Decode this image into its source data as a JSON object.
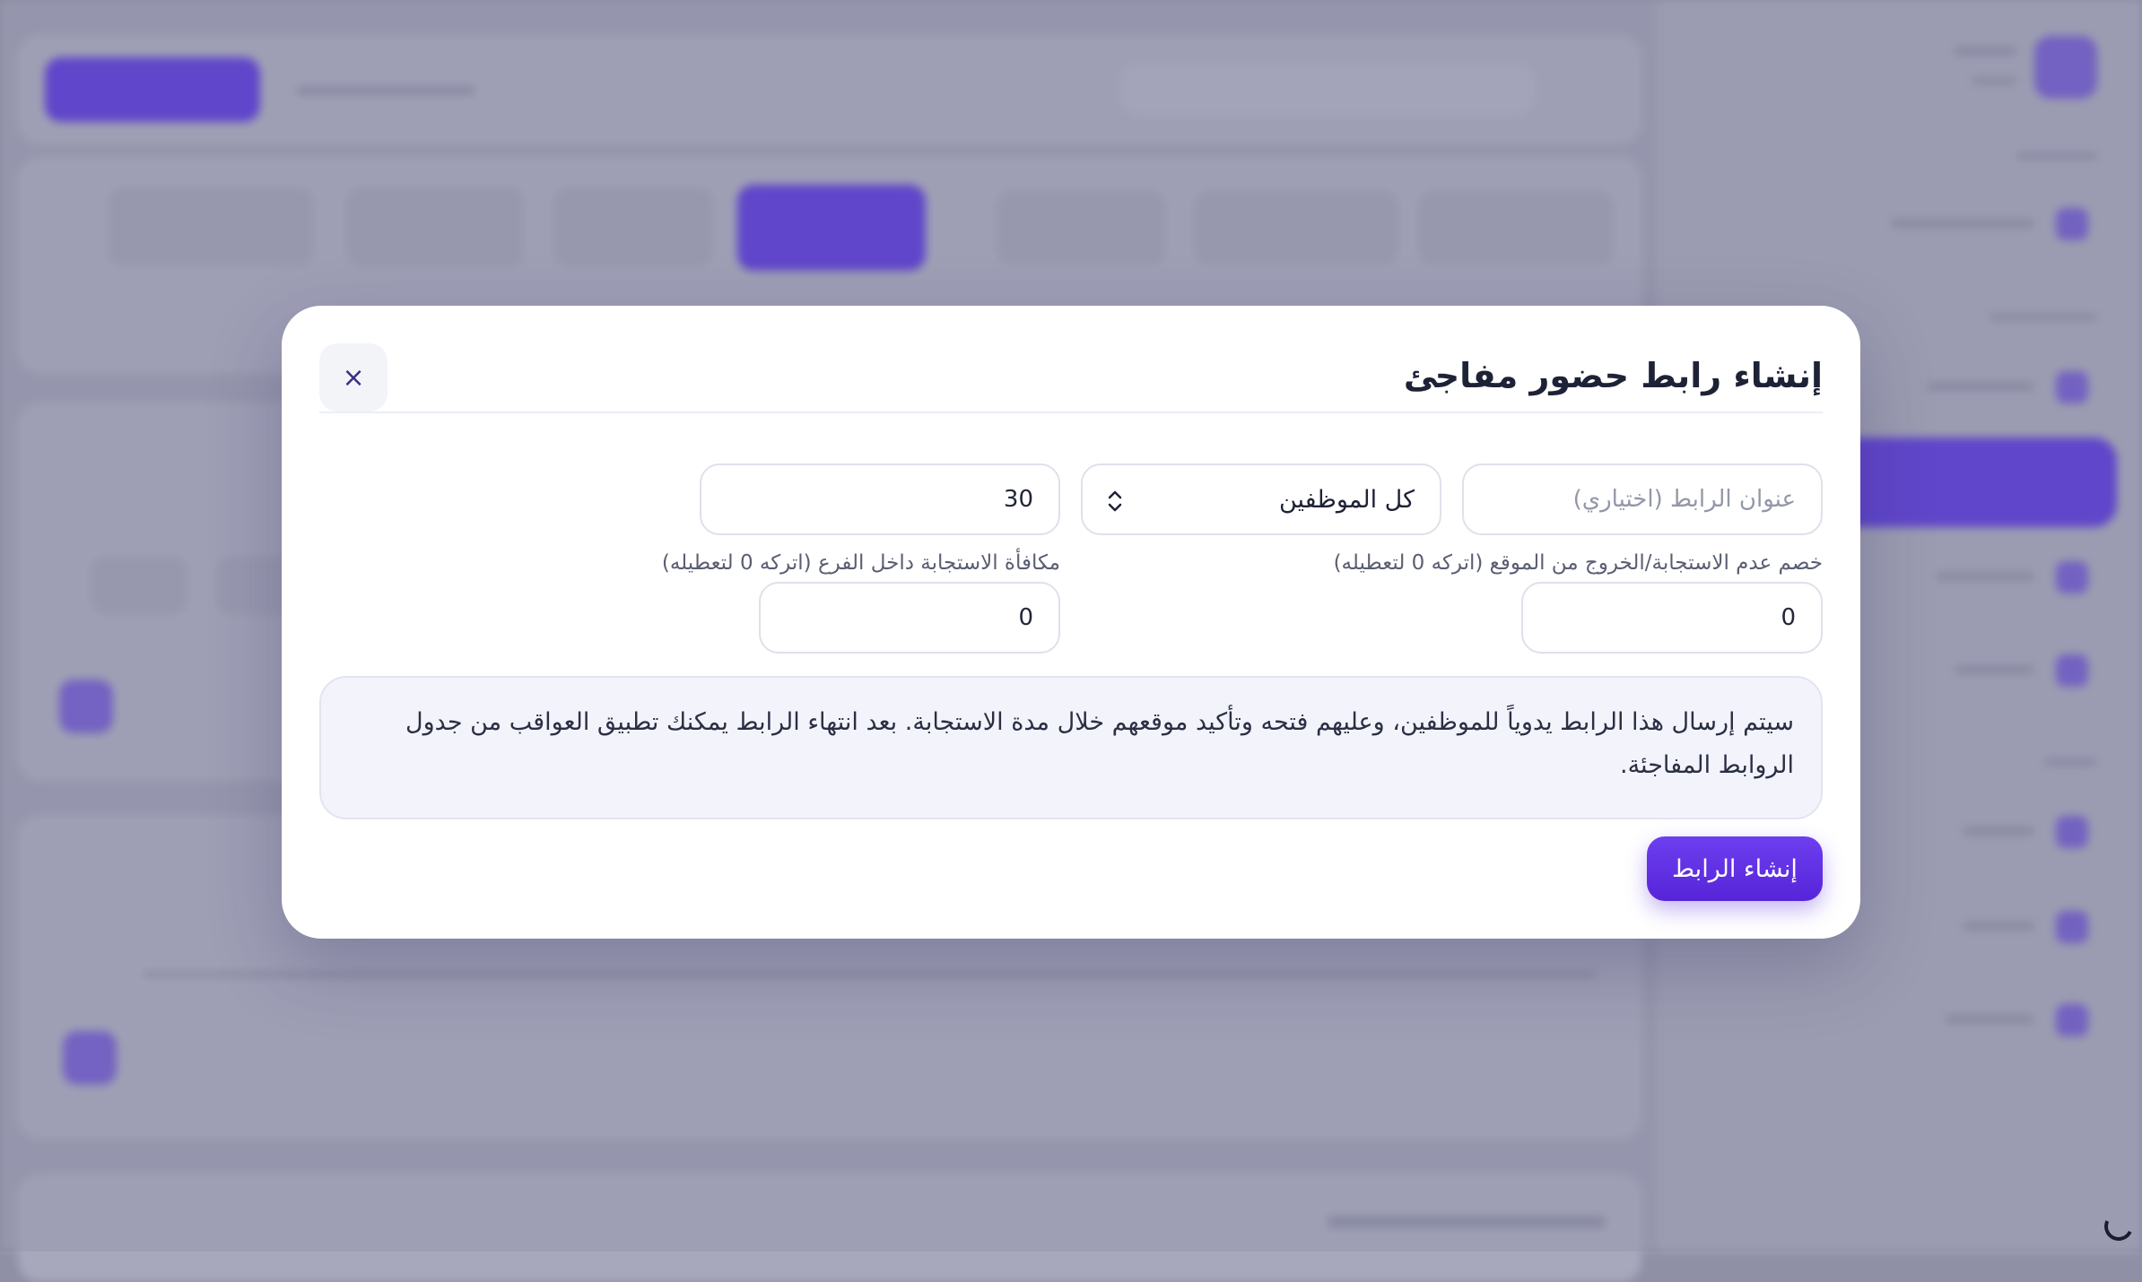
{
  "modal": {
    "title": "إنشاء رابط حضور مفاجئ",
    "close_label": "×",
    "link_title_placeholder": "عنوان الرابط (اختياري)",
    "employees_select_value": "كل الموظفين",
    "response_minutes_value": "30",
    "penalty_label": "خصم عدم الاستجابة/الخروج من الموقع (اتركه 0 لتعطيله)",
    "penalty_value": "0",
    "reward_label": "مكافأة الاستجابة داخل الفرع (اتركه 0 لتعطيله)",
    "reward_value": "0",
    "info_text": "سيتم إرسال هذا الرابط يدوياً للموظفين، وعليهم فتحه وتأكيد موقعهم خلال مدة الاستجابة. بعد انتهاء الرابط يمكنك تطبيق العواقب من جدول الروابط المفاجئة.",
    "submit_label": "إنشاء الرابط"
  },
  "colors": {
    "accent": "#5b2ee0",
    "overlay": "#9c9db2",
    "modal_bg": "#ffffff"
  }
}
